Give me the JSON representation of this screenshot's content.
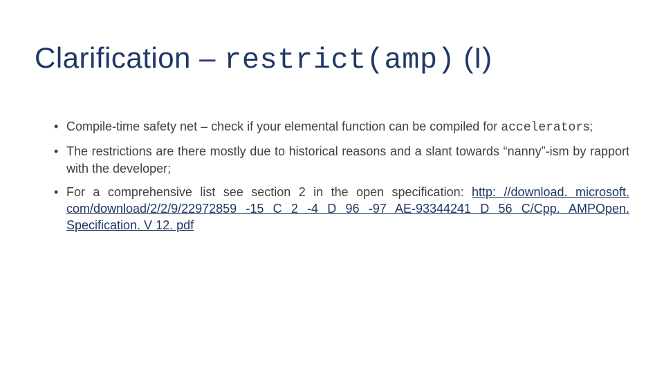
{
  "title": {
    "prefix": "Clarification – ",
    "code": "restrict(amp)",
    "suffix": " (I)"
  },
  "bullets": {
    "b1_a": "Compile-time safety net – check if your elemental function can be compiled for ",
    "b1_code": "accelerator",
    "b1_b": "s;",
    "b2": "The restrictions are there mostly due to historical reasons and a slant towards “nanny”-ism by rapport with the developer;",
    "b3_a": "For a comprehensive list see section 2 in the open specification: ",
    "b3_link": "http: //download. microsoft. com/download/2/2/9/22972859 -15 C 2 -4 D 96 -97 AE-93344241 D 56 C/Cpp. AMPOpen. Specification. V 12. pdf"
  }
}
